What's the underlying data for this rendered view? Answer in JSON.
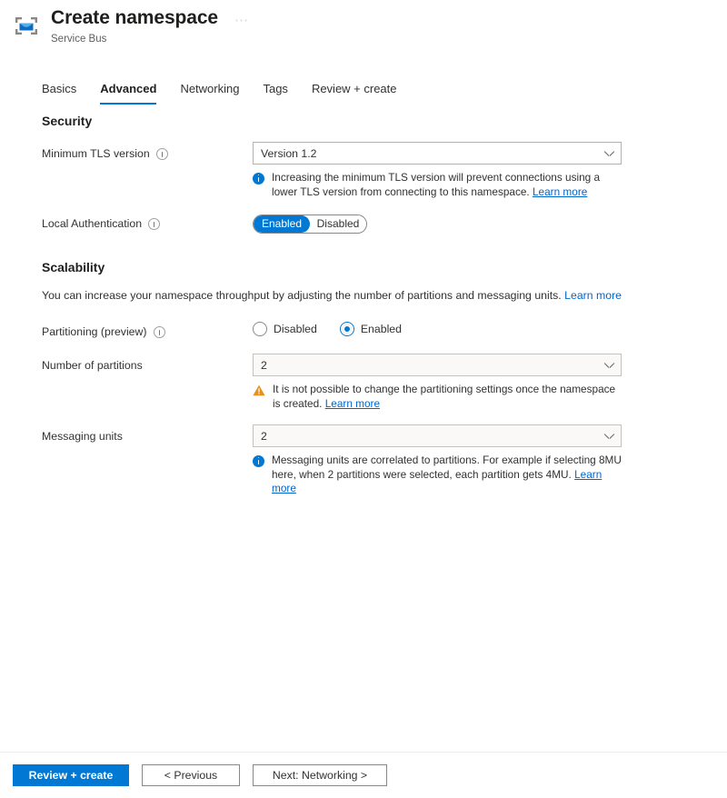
{
  "header": {
    "icon": "service-bus-icon",
    "title": "Create namespace",
    "subtitle": "Service Bus",
    "more_label": "⋯"
  },
  "tabs": [
    {
      "label": "Basics",
      "active": false
    },
    {
      "label": "Advanced",
      "active": true
    },
    {
      "label": "Networking",
      "active": false
    },
    {
      "label": "Tags",
      "active": false
    },
    {
      "label": "Review + create",
      "active": false
    }
  ],
  "security": {
    "section_title": "Security",
    "tls": {
      "label": "Minimum TLS version",
      "value": "Version 1.2",
      "info_icon": "info-circle-icon",
      "message": "Increasing the minimum TLS version will prevent connections using a lower TLS version from connecting to this namespace.",
      "message_link": "Learn more",
      "message_icon": "info-filled-icon"
    },
    "local_auth": {
      "label": "Local Authentication",
      "info_icon": "info-circle-icon",
      "options": [
        "Enabled",
        "Disabled"
      ],
      "selected": "Enabled"
    }
  },
  "scalability": {
    "section_title": "Scalability",
    "description": "You can increase your namespace throughput by adjusting the number of partitions and messaging units.",
    "description_link": "Learn more",
    "partitioning": {
      "label": "Partitioning (preview)",
      "info_icon": "info-circle-icon",
      "options": [
        "Disabled",
        "Enabled"
      ],
      "selected": "Enabled"
    },
    "partitions": {
      "label": "Number of partitions",
      "value": "2",
      "message": "It is not possible to change the partitioning settings once the namespace is created.",
      "message_link": "Learn more",
      "message_icon": "warning-triangle-icon"
    },
    "messaging_units": {
      "label": "Messaging units",
      "value": "2",
      "message": "Messaging units are correlated to partitions. For example if selecting 8MU here, when 2 partitions were selected, each partition gets 4MU.",
      "message_link": "Learn more",
      "message_icon": "info-filled-icon"
    }
  },
  "footer": {
    "review_create": "Review + create",
    "previous": "< Previous",
    "next": "Next: Networking >"
  },
  "colors": {
    "accent": "#0078d4",
    "link": "#0066cc",
    "warning": "#e8901c",
    "text": "#323130",
    "border": "#8a8886"
  }
}
